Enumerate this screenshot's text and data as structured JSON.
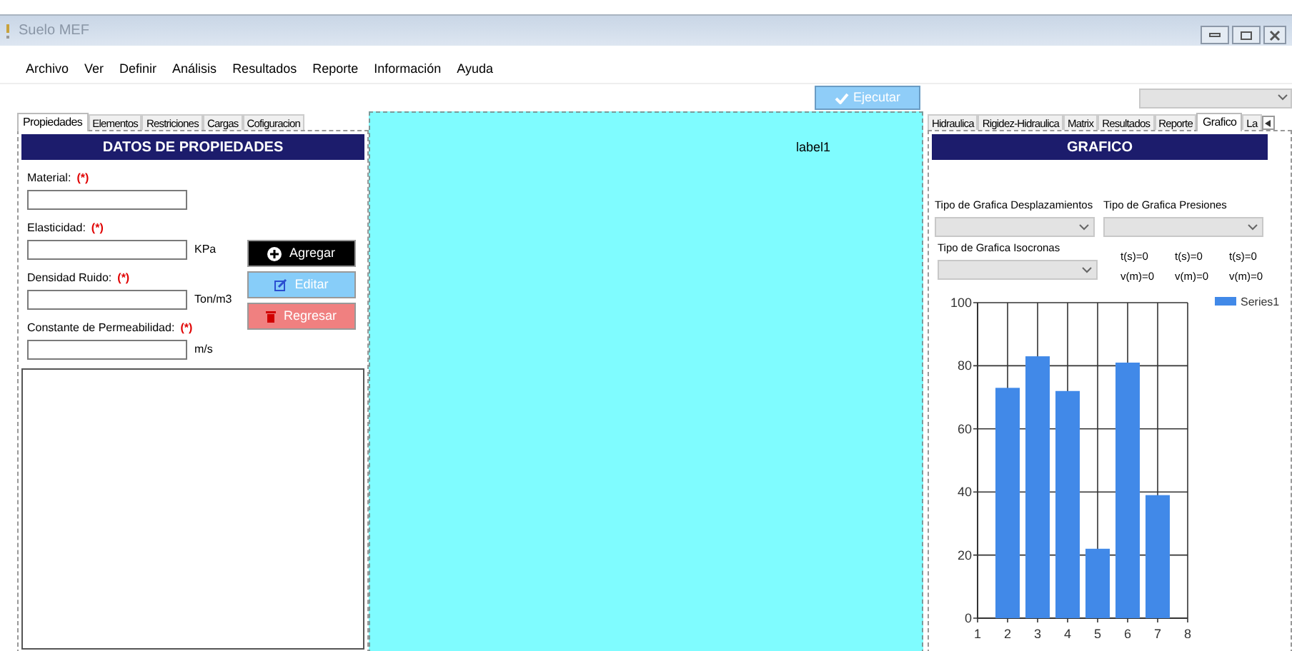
{
  "window": {
    "title": "Suelo MEF"
  },
  "menu": [
    "Archivo",
    "Ver",
    "Definir",
    "Análisis",
    "Resultados",
    "Reporte",
    "Información",
    "Ayuda"
  ],
  "toolbar": {
    "run_button": "Ejecutar"
  },
  "left_tabs": [
    {
      "label": "Propiedades",
      "selected": true
    },
    {
      "label": "Elementos",
      "selected": false
    },
    {
      "label": "Restriciones",
      "selected": false
    },
    {
      "label": "Cargas",
      "selected": false
    },
    {
      "label": "Cofiguracion",
      "selected": false
    }
  ],
  "properties": {
    "header": "DATOS DE PROPIEDADES",
    "fields": [
      {
        "label": "Material:",
        "required": "(*)"
      },
      {
        "label": "Elasticidad:",
        "required": "(*)",
        "unit": "KPa"
      },
      {
        "label": "Densidad Ruido:",
        "required": "(*)",
        "unit": "Ton/m3"
      },
      {
        "label": "Constante de Permeabilidad:",
        "required": "(*)",
        "unit": "m/s"
      }
    ],
    "buttons": [
      {
        "label": "Agregar",
        "kind": "add"
      },
      {
        "label": "Editar",
        "kind": "edit"
      },
      {
        "label": "Regresar",
        "kind": "back"
      }
    ]
  },
  "canvas": {
    "label": "label1"
  },
  "right_tabs": [
    {
      "label": "Hidraulica",
      "selected": false
    },
    {
      "label": "Rigidez-Hidraulica",
      "selected": false
    },
    {
      "label": "Matrix",
      "selected": false
    },
    {
      "label": "Resultados",
      "selected": false
    },
    {
      "label": "Reporte",
      "selected": false
    },
    {
      "label": "Grafico",
      "selected": true
    },
    {
      "label": "La",
      "selected": false
    }
  ],
  "graph": {
    "header": "GRAFICO",
    "selectors": [
      {
        "label": "Tipo de Grafica Desplazamientos"
      },
      {
        "label": "Tipo de Grafica Presiones"
      },
      {
        "label": "Tipo de Grafica Isocronas"
      }
    ],
    "readings": [
      {
        "time": "t(s)=0",
        "value": "v(m)=0"
      },
      {
        "time": "t(s)=0",
        "value": "v(m)=0"
      },
      {
        "time": "t(s)=0",
        "value": "v(m)=0"
      }
    ],
    "chart_data": {
      "type": "bar",
      "x": [
        2,
        3,
        4,
        5,
        6,
        7
      ],
      "series": [
        {
          "name": "Series1",
          "color": "#4189e8",
          "values": [
            73,
            83,
            72,
            22,
            81,
            39
          ]
        }
      ],
      "grid": true,
      "xlim": [
        1,
        8
      ],
      "ylim": [
        0,
        100
      ],
      "xticks": [
        1,
        2,
        3,
        4,
        5,
        6,
        7,
        8
      ],
      "yticks": [
        0,
        20,
        40,
        60,
        80,
        100
      ]
    }
  }
}
